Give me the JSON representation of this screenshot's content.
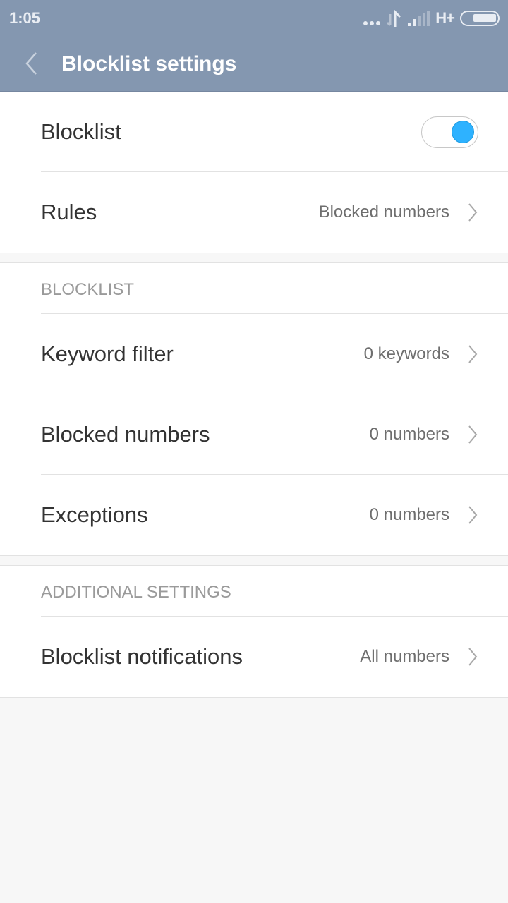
{
  "status_bar": {
    "time": "1:05",
    "network_type": "H+",
    "icons": [
      "more-dots-icon",
      "data-transfer-icon",
      "signal-icon",
      "battery-icon"
    ]
  },
  "header": {
    "back_icon": "chevron-left-icon",
    "title": "Blocklist settings"
  },
  "main_section": {
    "blocklist_toggle": {
      "label": "Blocklist",
      "enabled": true,
      "accent_color": "#2eb2ff"
    },
    "rules": {
      "label": "Rules",
      "value": "Blocked numbers"
    }
  },
  "blocklist_section": {
    "header": "BLOCKLIST",
    "items": [
      {
        "label": "Keyword filter",
        "value": "0 keywords"
      },
      {
        "label": "Blocked numbers",
        "value": "0 numbers"
      },
      {
        "label": "Exceptions",
        "value": "0 numbers"
      }
    ]
  },
  "additional_section": {
    "header": "ADDITIONAL SETTINGS",
    "items": [
      {
        "label": "Blocklist notifications",
        "value": "All numbers"
      }
    ]
  },
  "colors": {
    "header_bg": "#8497b0",
    "accent": "#2eb2ff",
    "page_bg": "#f7f7f7"
  }
}
